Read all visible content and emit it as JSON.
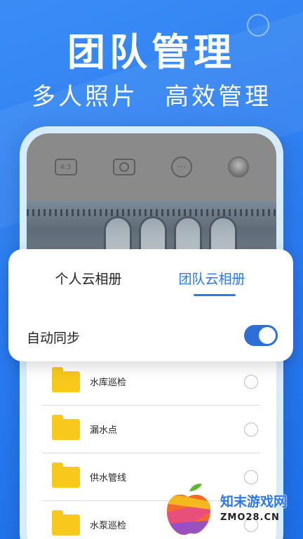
{
  "header": {
    "title": "团队管理",
    "subtitle": "多人照片　高效管理"
  },
  "camera_bar": {
    "ratio_label": "4:3",
    "more_label": "⋯"
  },
  "album_tabs": {
    "personal": "个人云相册",
    "team": "团队云相册",
    "active": "team"
  },
  "sync": {
    "label": "自动同步",
    "enabled": true
  },
  "folders": [
    {
      "name": "水库巡检"
    },
    {
      "name": "漏水点"
    },
    {
      "name": "供水管线"
    },
    {
      "name": "水泵巡检"
    }
  ],
  "watermark": {
    "site_name": "知末游戏网",
    "url": "ZMO28.CN"
  },
  "colors": {
    "background": "#2a7af0",
    "accent": "#2a78ea",
    "folder": "#f8c81c",
    "toggle": "#2d6fd6"
  }
}
